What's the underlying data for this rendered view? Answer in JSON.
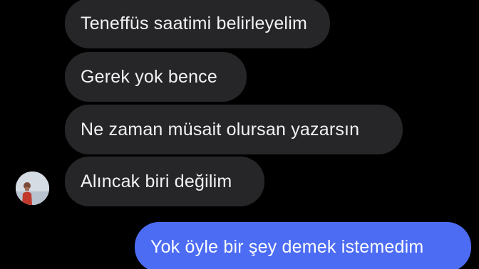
{
  "conversation": {
    "messages": [
      {
        "sender": "other",
        "text": "Teneffüs saatimi belirleyelim"
      },
      {
        "sender": "other",
        "text": "Gerek yok bence"
      },
      {
        "sender": "other",
        "text": "Ne zaman müsait olursan yazarsın"
      },
      {
        "sender": "other",
        "text": "Alıncak biri değilim"
      },
      {
        "sender": "me",
        "text": "Yok öyle bir şey demek istemedim"
      }
    ]
  },
  "colors": {
    "background": "#000000",
    "incoming_bubble": "#262628",
    "outgoing_bubble": "#4c6cf4",
    "text": "#f2f2f4"
  },
  "icons": {
    "avatar": "contact-avatar-photo"
  }
}
